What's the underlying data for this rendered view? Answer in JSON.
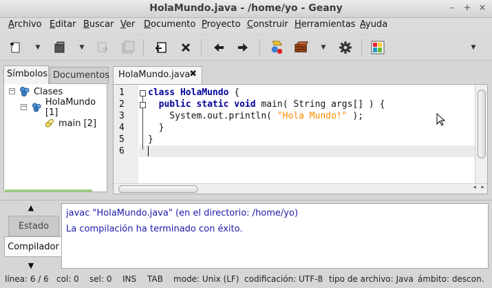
{
  "window": {
    "title": "HolaMundo.java - /home/yo - Geany"
  },
  "menu": [
    {
      "label": "Archivo",
      "mnemonic": "A",
      "rest": "rchivo"
    },
    {
      "label": "Editar",
      "mnemonic": "E",
      "rest": "ditar"
    },
    {
      "label": "Buscar",
      "mnemonic": "B",
      "rest": "uscar"
    },
    {
      "label": "Ver",
      "mnemonic": "V",
      "rest": "er"
    },
    {
      "label": "Documento",
      "mnemonic": "D",
      "rest": "ocumento"
    },
    {
      "label": "Proyecto",
      "mnemonic": "P",
      "rest": "royecto"
    },
    {
      "label": "Construir",
      "mnemonic": "C",
      "rest": "onstruir"
    },
    {
      "label": "Herramientas",
      "mnemonic": "H",
      "rest": "erramientas"
    },
    {
      "label": "Ayuda",
      "mnemonic": "A",
      "rest": "yuda"
    }
  ],
  "toolbar": {
    "icons": [
      "new-file-icon",
      "open-file-icon",
      "save-icon",
      "save-all-icon",
      "revert-icon",
      "close-icon",
      "back-icon",
      "forward-icon",
      "compile-icon",
      "build-icon",
      "preferences-icon",
      "color-chooser-icon"
    ]
  },
  "sidebar": {
    "tabs": [
      "Símbolos",
      "Documentos"
    ],
    "tree": [
      {
        "label": "Clases",
        "level": 0
      },
      {
        "label": "HolaMundo [1]",
        "level": 1
      },
      {
        "label": "main [2]",
        "level": 2
      }
    ]
  },
  "editor": {
    "tab_label": "HolaMundo.java",
    "line_numbers": [
      "1",
      "2",
      "3",
      "4",
      "5",
      "6"
    ],
    "lines": [
      [
        {
          "t": "class",
          "c": "kw"
        },
        {
          "t": " "
        },
        {
          "t": "HolaMundo",
          "c": "cls"
        },
        {
          "t": " {"
        }
      ],
      [
        {
          "t": "  "
        },
        {
          "t": "public",
          "c": "kw"
        },
        {
          "t": " "
        },
        {
          "t": "static",
          "c": "kw"
        },
        {
          "t": " "
        },
        {
          "t": "void",
          "c": "kw"
        },
        {
          "t": " main( String args[] ) {"
        }
      ],
      [
        {
          "t": "    System.out.println( "
        },
        {
          "t": "\"Hola Mundo!\"",
          "c": "str"
        },
        {
          "t": " );"
        }
      ],
      [
        {
          "t": "  }"
        }
      ],
      [
        {
          "t": "}"
        }
      ],
      [
        {
          "t": ""
        }
      ]
    ]
  },
  "bottom_panel": {
    "tabs": [
      "Estado",
      "Compilador"
    ],
    "messages": [
      "javac \"HolaMundo.java\" (en el directorio: /home/yo)",
      "La compilación ha terminado con éxito."
    ]
  },
  "status_bar": {
    "line": "línea: 6 / 6",
    "col": "col: 0",
    "sel": "sel: 0",
    "ins": "INS",
    "tab": "TAB",
    "mode": "mode: Unix (LF)",
    "encoding": "codificación: UTF-8",
    "filetype": "tipo de archivo: Java",
    "scope": "ámbito: descon."
  }
}
